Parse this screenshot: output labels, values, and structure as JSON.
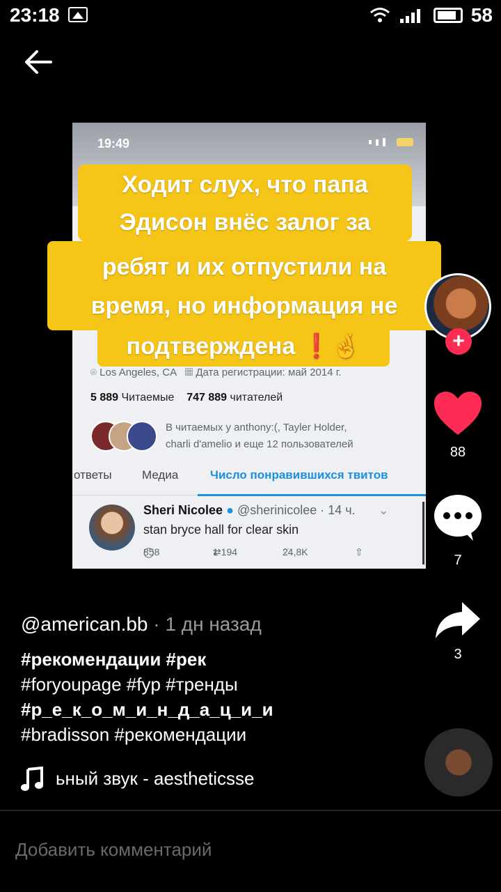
{
  "status_bar": {
    "time": "23:18",
    "battery": "58"
  },
  "video": {
    "time": "19:49",
    "location": "Los Angeles, CA",
    "joined": "Дата регистрации: май 2014 г.",
    "following_count": "5 889",
    "following_label": "Читаемые",
    "followers_count": "747 889",
    "followers_label": "читателей",
    "follows_line1": "В читаемых у anthony:(, Tayler Holder,",
    "follows_line2": "charli d'amelio и еще 12 пользователей",
    "tabs": [
      "ответы",
      "Медиа",
      "Число понравившихся твитов"
    ],
    "tweet": {
      "name": "Sheri Nicolee",
      "handle": "@sherinicolee · 14 ч.",
      "text": "stan bryce hall for clear skin",
      "replies": "858",
      "retweets": "1 194",
      "likes": "24,8K"
    }
  },
  "caption_lines": [
    "Ходит слух, что папа",
    "Эдисон внёс залог за",
    "ребят и их отпустили на",
    "время, но информация не",
    "подтверждена ❗🤞"
  ],
  "sidebar": {
    "likes": "88",
    "comments": "7",
    "shares": "3",
    "follow_symbol": "+"
  },
  "post": {
    "author": "@american.bb",
    "time": "· 1 дн назад",
    "tag_lines": [
      "#рекомендации #рек",
      "#foryoupage #fyp #тренды",
      "#р_е_к_о_м_и_н_д_а_ц_и_и",
      "#bradisson #рекомендации"
    ],
    "music": "ьный звук - aestheticsse"
  },
  "comment_placeholder": "Добавить комментарий",
  "colors": {
    "accent": "#fe2c55",
    "caption_bg": "#f5c518",
    "link_blue": "#1d8fe0"
  }
}
